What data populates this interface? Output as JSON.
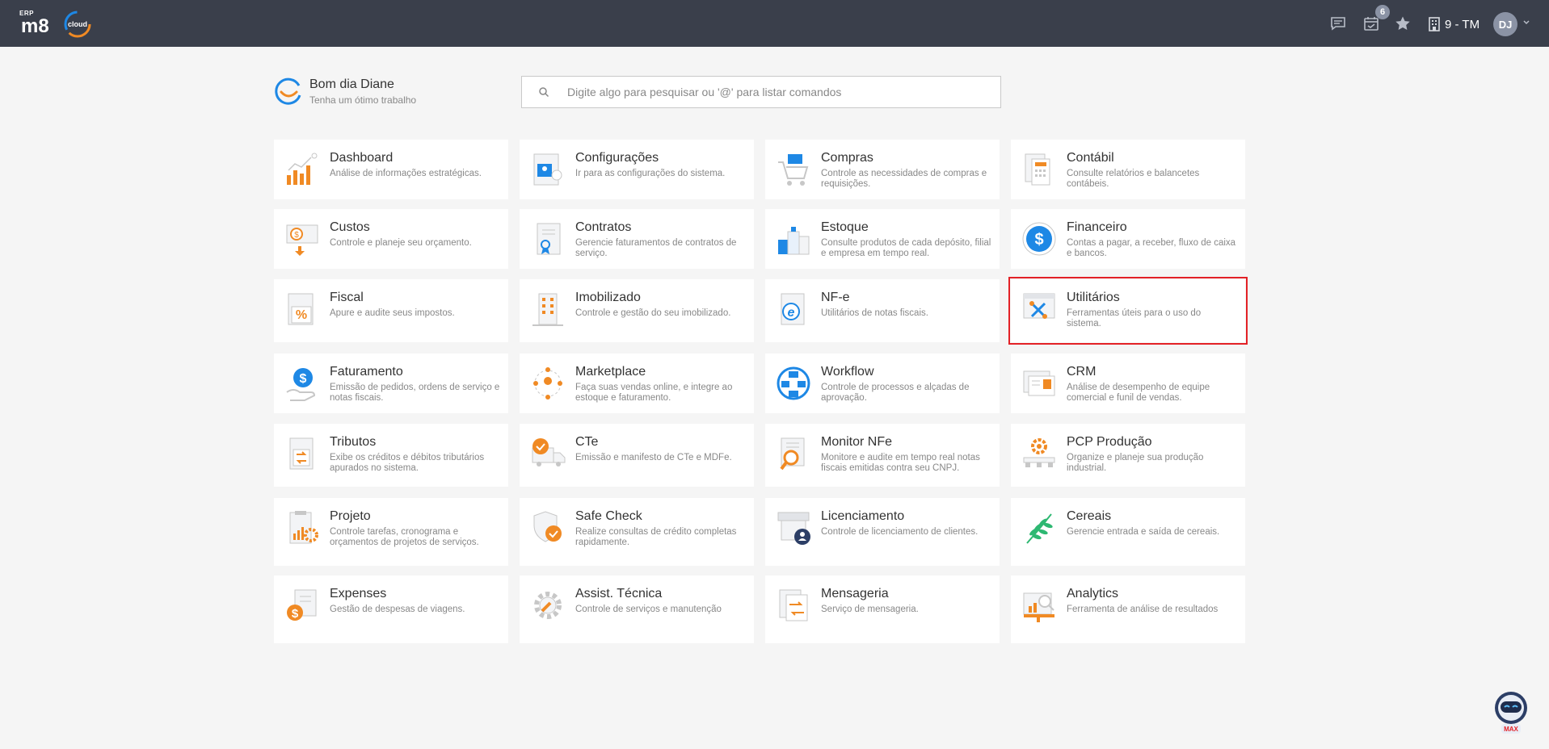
{
  "header": {
    "logo_prefix": "ERP",
    "logo_text": "m8",
    "logo_suffix": "cloud",
    "notifications_badge": "6",
    "company_label": "9 - TM",
    "avatar_initials": "DJ"
  },
  "greeting": {
    "title": "Bom dia Diane",
    "subtitle": "Tenha um ótimo trabalho"
  },
  "search": {
    "placeholder": "Digite algo para pesquisar ou '@' para listar comandos"
  },
  "modules": [
    {
      "title": "Dashboard",
      "desc": "Análise de informações estratégicas.",
      "icon": "dashboard-icon"
    },
    {
      "title": "Configurações",
      "desc": "Ir para as configurações do sistema.",
      "icon": "settings-icon"
    },
    {
      "title": "Compras",
      "desc": "Controle as necessidades de compras e requisições.",
      "icon": "cart-icon"
    },
    {
      "title": "Contábil",
      "desc": "Consulte relatórios e balancetes contábeis.",
      "icon": "calculator-icon"
    },
    {
      "title": "Custos",
      "desc": "Controle e planeje seu orçamento.",
      "icon": "costs-icon"
    },
    {
      "title": "Contratos",
      "desc": "Gerencie faturamentos de contratos de serviço.",
      "icon": "contract-icon"
    },
    {
      "title": "Estoque",
      "desc": "Consulte produtos de cada depósito, filial e empresa em tempo real.",
      "icon": "warehouse-icon"
    },
    {
      "title": "Financeiro",
      "desc": "Contas a pagar, a receber, fluxo de caixa e bancos.",
      "icon": "dollar-icon"
    },
    {
      "title": "Fiscal",
      "desc": "Apure e audite seus impostos.",
      "icon": "percent-doc-icon"
    },
    {
      "title": "Imobilizado",
      "desc": "Controle e gestão do seu imobilizado.",
      "icon": "building-icon"
    },
    {
      "title": "NF-e",
      "desc": "Utilitários de notas fiscais.",
      "icon": "nfe-icon"
    },
    {
      "title": "Utilitários",
      "desc": "Ferramentas úteis para o uso do sistema.",
      "icon": "tools-icon"
    },
    {
      "title": "Faturamento",
      "desc": "Emissão de pedidos, ordens de serviço e notas fiscais.",
      "icon": "billing-icon"
    },
    {
      "title": "Marketplace",
      "desc": "Faça suas vendas online, e integre ao estoque e faturamento.",
      "icon": "network-icon"
    },
    {
      "title": "Workflow",
      "desc": "Controle de processos e alçadas de aprovação.",
      "icon": "workflow-icon"
    },
    {
      "title": "CRM",
      "desc": "Análise de desempenho de equipe comercial e funil de vendas.",
      "icon": "crm-icon"
    },
    {
      "title": "Tributos",
      "desc": "Exibe os créditos e débitos tributários apurados no sistema.",
      "icon": "tax-icon"
    },
    {
      "title": "CTe",
      "desc": "Emissão e manifesto de CTe e MDFe.",
      "icon": "truck-icon"
    },
    {
      "title": "Monitor NFe",
      "desc": "Monitore e audite em tempo real notas fiscais emitidas contra seu CNPJ.",
      "icon": "magnifier-doc-icon"
    },
    {
      "title": "PCP Produção",
      "desc": "Organize e planeje sua produção industrial.",
      "icon": "production-icon"
    },
    {
      "title": "Projeto",
      "desc": "Controle tarefas, cronograma e orçamentos de projetos de serviços.",
      "icon": "project-icon"
    },
    {
      "title": "Safe Check",
      "desc": "Realize consultas de crédito completas rapidamente.",
      "icon": "shield-check-icon"
    },
    {
      "title": "Licenciamento",
      "desc": "Controle de licenciamento de clientes.",
      "icon": "license-icon"
    },
    {
      "title": "Cereais",
      "desc": "Gerencie entrada e saída de cereais.",
      "icon": "grain-icon"
    },
    {
      "title": "Expenses",
      "desc": "Gestão de despesas de viagens.",
      "icon": "expenses-icon"
    },
    {
      "title": "Assist. Técnica",
      "desc": "Controle de serviços e manutenção",
      "icon": "gear-icon"
    },
    {
      "title": "Mensageria",
      "desc": "Serviço de mensageria.",
      "icon": "messaging-icon"
    },
    {
      "title": "Analytics",
      "desc": "Ferramenta de análise de resultados",
      "icon": "analytics-icon"
    }
  ],
  "selected_module": "Utilitários",
  "bot_label": "MAX",
  "colors": {
    "topbar": "#3a3f4b",
    "accent_orange": "#f08a24",
    "accent_blue": "#1e88e5",
    "highlight": "#e32126"
  }
}
